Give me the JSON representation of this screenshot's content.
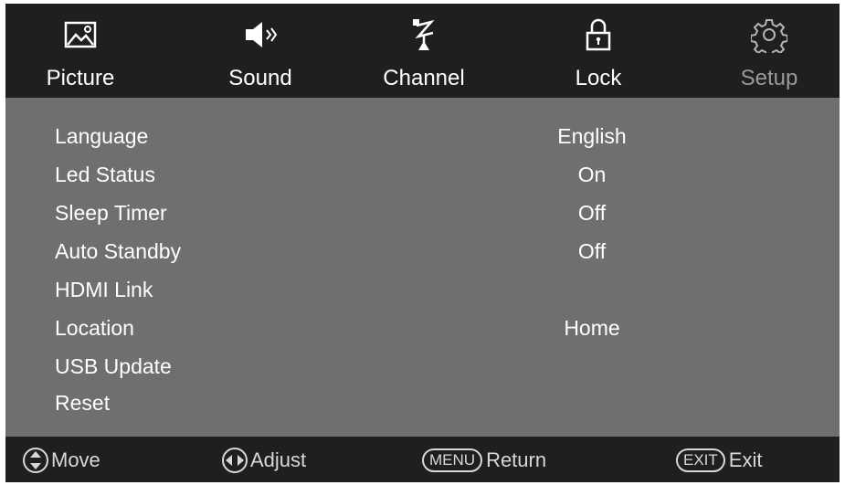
{
  "tabs": [
    {
      "label": "Picture",
      "icon": "picture-icon"
    },
    {
      "label": "Sound",
      "icon": "speaker-icon"
    },
    {
      "label": "Channel",
      "icon": "antenna-icon"
    },
    {
      "label": "Lock",
      "icon": "lock-icon"
    },
    {
      "label": "Setup",
      "icon": "gear-icon",
      "active": true
    }
  ],
  "menu": [
    {
      "name": "Language",
      "value": "English"
    },
    {
      "name": "Led Status",
      "value": "On"
    },
    {
      "name": "Sleep Timer",
      "value": "Off"
    },
    {
      "name": "Auto Standby",
      "value": "Off"
    },
    {
      "name": "HDMI Link",
      "value": ""
    },
    {
      "name": "Location",
      "value": "Home"
    },
    {
      "name": "USB Update",
      "value": ""
    },
    {
      "name": "Reset",
      "value": ""
    }
  ],
  "hints": {
    "move": {
      "icon": "up-down-arrows-icon",
      "label": "Move"
    },
    "adjust": {
      "icon": "left-right-arrows-icon",
      "label": "Adjust"
    },
    "return": {
      "key": "MENU",
      "label": "Return"
    },
    "exit": {
      "key": "EXIT",
      "label": "Exit"
    }
  },
  "colors": {
    "bar": "#1f1f1f",
    "panel": "#6f6f6f",
    "text": "#ffffff",
    "active_tab_text": "#9a9a9a"
  }
}
